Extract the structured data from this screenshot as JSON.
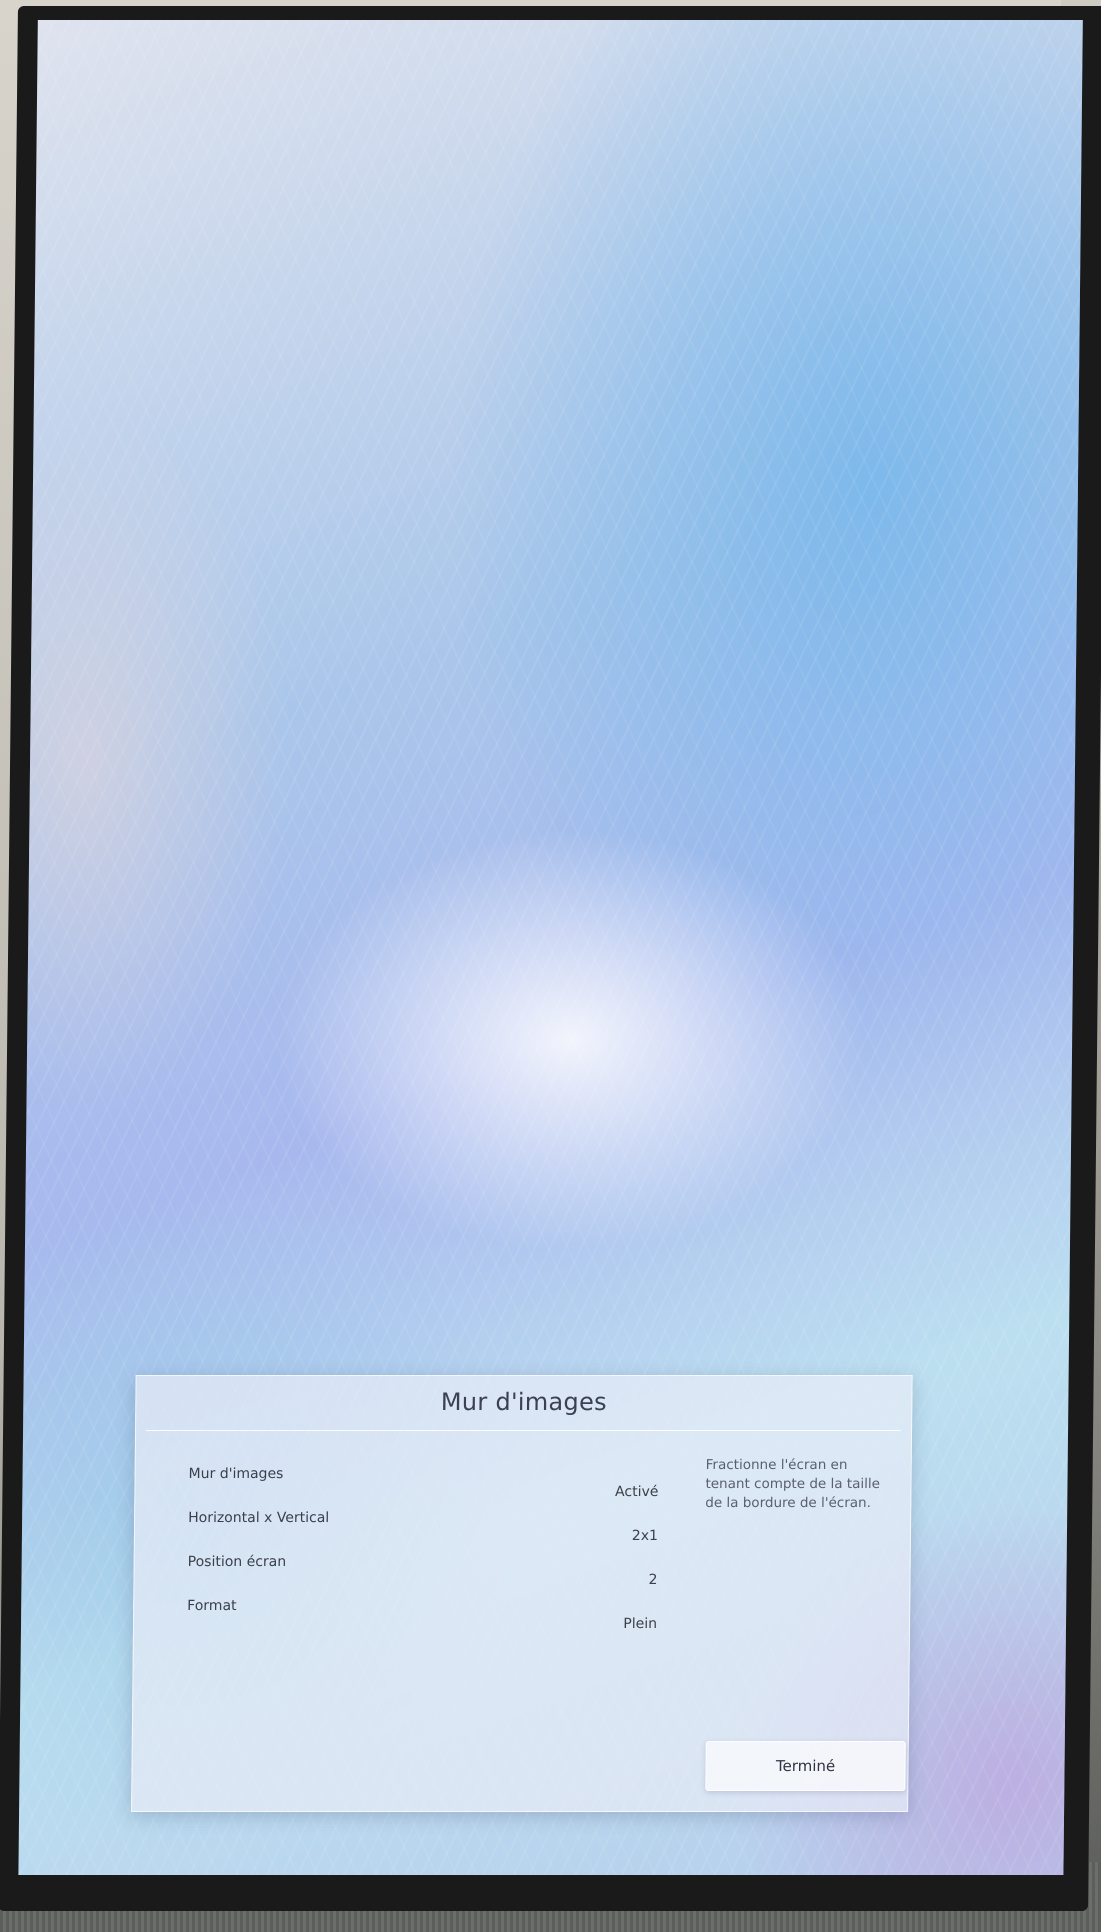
{
  "dialog": {
    "title": "Mur d'images",
    "settings": [
      {
        "label": "Mur d'images",
        "value": "Activé"
      },
      {
        "label": "Horizontal x Vertical",
        "value": "2x1"
      },
      {
        "label": "Position écran",
        "value": "2"
      },
      {
        "label": "Format",
        "value": "Plein"
      }
    ],
    "description": "Fractionne l'écran en tenant compte de la taille de la bordure de l'écran.",
    "done_label": "Terminé"
  }
}
